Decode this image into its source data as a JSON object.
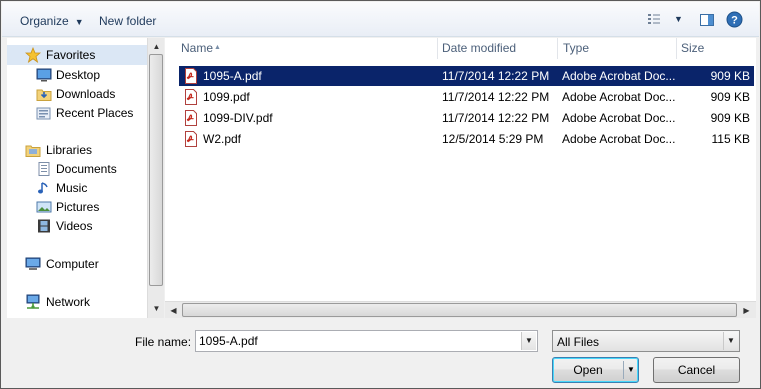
{
  "toolbar": {
    "organize": "Organize",
    "new_folder": "New folder"
  },
  "nav": {
    "favorites": "Favorites",
    "favorites_items": [
      "Desktop",
      "Downloads",
      "Recent Places"
    ],
    "libraries": "Libraries",
    "libraries_items": [
      "Documents",
      "Music",
      "Pictures",
      "Videos"
    ],
    "computer": "Computer",
    "network": "Network"
  },
  "columns": {
    "name": "Name",
    "date": "Date modified",
    "type": "Type",
    "size": "Size"
  },
  "files": [
    {
      "name": "1095-A.pdf",
      "date": "11/7/2014 12:22 PM",
      "type": "Adobe Acrobat Doc...",
      "size": "909 KB",
      "selected": true
    },
    {
      "name": "1099.pdf",
      "date": "11/7/2014 12:22 PM",
      "type": "Adobe Acrobat Doc...",
      "size": "909 KB",
      "selected": false
    },
    {
      "name": "1099-DIV.pdf",
      "date": "11/7/2014 12:22 PM",
      "type": "Adobe Acrobat Doc...",
      "size": "909 KB",
      "selected": false
    },
    {
      "name": "W2.pdf",
      "date": "12/5/2014 5:29 PM",
      "type": "Adobe Acrobat Doc...",
      "size": "115 KB",
      "selected": false
    }
  ],
  "bottom": {
    "file_name_label": "File name:",
    "file_name_value": "1095-A.pdf",
    "file_type_value": "All Files",
    "open_label": "Open",
    "cancel_label": "Cancel"
  },
  "icons": {
    "favorites": "star-icon",
    "desktop": "desktop-icon",
    "downloads": "downloads-folder-icon",
    "recent": "recent-places-icon",
    "libraries": "library-icon",
    "documents": "documents-icon",
    "music": "music-icon",
    "pictures": "pictures-icon",
    "videos": "videos-icon",
    "computer": "computer-icon",
    "network": "network-icon",
    "file": "pdf-file-icon"
  },
  "colors": {
    "selection": "#0a246a",
    "hover_nav": "#dbe7f5",
    "pdf_red": "#c4281c"
  }
}
